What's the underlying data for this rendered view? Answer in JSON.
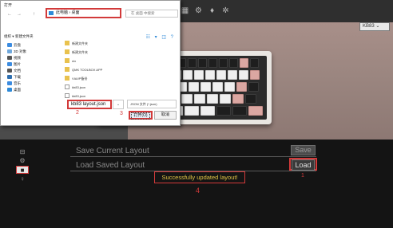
{
  "colors": {
    "annotation_red": "#d23a3a",
    "success_yellow": "#e1c545",
    "keycap_pink": "#dba7a2",
    "app_background": "#141414"
  },
  "app": {
    "device_select": "KB83",
    "top_icons": [
      "keyboard-icon",
      "gear-icon",
      "bulb-icon",
      "settings-icon"
    ]
  },
  "file_dialog": {
    "title": "打开",
    "nav_back": "←",
    "nav_forward": "→",
    "nav_up": "↑",
    "address_path": "此电脑  ›  桌面",
    "search_placeholder": "在 桌面 中搜索",
    "toolbar_organize": "组织 ▾",
    "toolbar_new_folder": "新建文件夹",
    "view_icons": "☷ ▾  ◫  ?",
    "nav_items": [
      {
        "label": "云盘",
        "icon": "cloud-icon"
      },
      {
        "label": "3D 对象",
        "icon": "3d-objects-icon"
      },
      {
        "label": "视频",
        "icon": "video-icon"
      },
      {
        "label": "图片",
        "icon": "picture-icon"
      },
      {
        "label": "文档",
        "icon": "document-icon"
      },
      {
        "label": "下载",
        "icon": "download-icon"
      },
      {
        "label": "音乐",
        "icon": "music-icon"
      },
      {
        "label": "桌面",
        "icon": "desktop-icon"
      }
    ],
    "files": [
      {
        "name": "新建文件夹",
        "type": "folder"
      },
      {
        "name": "新建文件夹",
        "type": "folder"
      },
      {
        "name": "nix",
        "type": "folder"
      },
      {
        "name": "QMK TOOLBOX APP",
        "type": "folder"
      },
      {
        "name": "VIA/IP备份",
        "type": "folder"
      },
      {
        "name": "kb83.json",
        "type": "file"
      },
      {
        "name": "kb83.json",
        "type": "file"
      }
    ],
    "filename_value": "kb83 layout.json",
    "filename_dropdown": "⌄",
    "filetype_value": "JSON 文件 (*.json)",
    "open_button": "打开(O)",
    "cancel_button": "取消"
  },
  "steps": {
    "step1": "1",
    "step2": "2",
    "step3": "3",
    "step4": "4"
  },
  "panel": {
    "rail_icons": [
      "gamepad-icon",
      "gear-icon",
      "save-icon",
      "bulb-icon"
    ],
    "save_current_label": "Save Current Layout",
    "load_saved_label": "Load Saved Layout",
    "save_button": "Save",
    "load_button": "Load",
    "success_message": "Successfully updated layout!"
  }
}
